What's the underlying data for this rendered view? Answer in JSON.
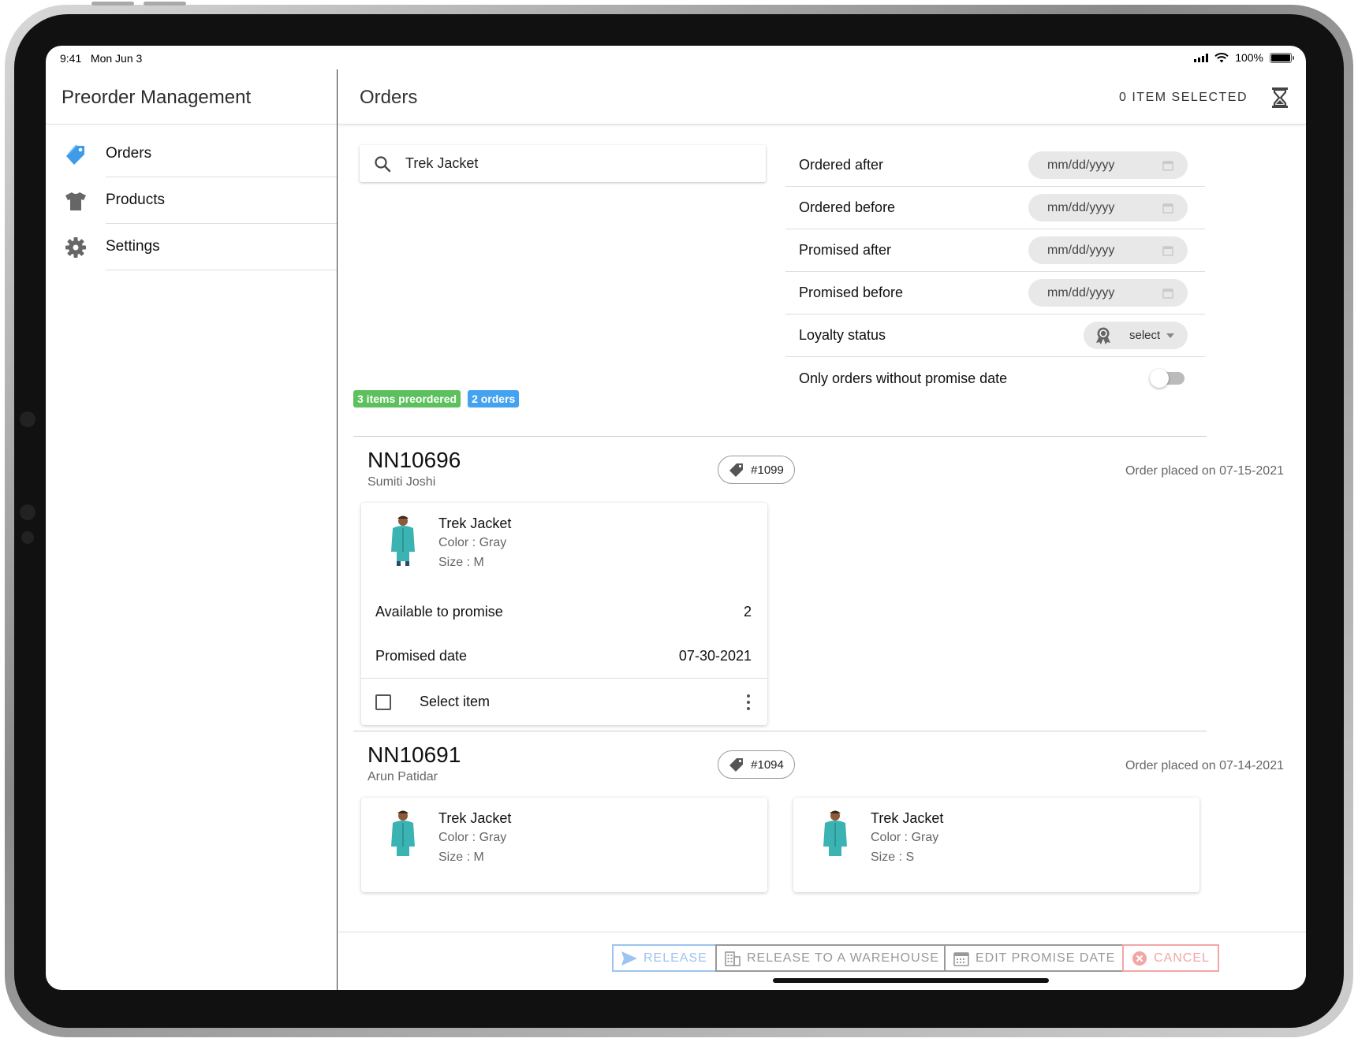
{
  "status_bar": {
    "time": "9:41",
    "date": "Mon Jun 3",
    "battery": "100%"
  },
  "sidebar": {
    "title": "Preorder Management",
    "items": [
      {
        "label": "Orders",
        "icon": "pricetag-icon",
        "color": "#3d9be9"
      },
      {
        "label": "Products",
        "icon": "shirt-icon",
        "color": "#666666"
      },
      {
        "label": "Settings",
        "icon": "gear-icon",
        "color": "#666666"
      }
    ]
  },
  "header": {
    "title": "Orders",
    "selected_count": "0 ITEM SELECTED",
    "icon": "hourglass-icon"
  },
  "search": {
    "value": "Trek Jacket",
    "icon": "search-icon"
  },
  "filters": {
    "ordered_after": {
      "label": "Ordered after",
      "value": "mm/dd/yyyy"
    },
    "ordered_before": {
      "label": "Ordered before",
      "value": "mm/dd/yyyy"
    },
    "promised_after": {
      "label": "Promised after",
      "value": "mm/dd/yyyy"
    },
    "promised_before": {
      "label": "Promised before",
      "value": "mm/dd/yyyy"
    },
    "loyalty": {
      "label": "Loyalty status",
      "value": "select",
      "icon": "ribbon-icon"
    },
    "no_promise": {
      "label": "Only orders without promise date",
      "enabled": false
    }
  },
  "summary": {
    "items_badge": "3 items preordered",
    "orders_badge": "2 orders",
    "items_color": "#5cc05c",
    "orders_color": "#44a3f0"
  },
  "orders": [
    {
      "id": "NN10696",
      "customer": "Sumiti Joshi",
      "tag": "#1099",
      "placed": "Order placed on 07-15-2021",
      "items": [
        {
          "name": "Trek Jacket",
          "color": "Color : Gray",
          "size": "Size : M",
          "atp_label": "Available to promise",
          "atp_value": "2",
          "promised_label": "Promised date",
          "promised_value": "07-30-2021",
          "select_label": "Select item"
        }
      ]
    },
    {
      "id": "NN10691",
      "customer": "Arun Patidar",
      "tag": "#1094",
      "placed": "Order placed on 07-14-2021",
      "items": [
        {
          "name": "Trek Jacket",
          "color": "Color : Gray",
          "size": "Size : M"
        },
        {
          "name": "Trek Jacket",
          "color": "Color : Gray",
          "size": "Size : S"
        }
      ]
    }
  ],
  "footer": {
    "release": "RELEASE",
    "release_warehouse": "RELEASE TO A WAREHOUSE",
    "edit_promise": "EDIT PROMISE DATE",
    "cancel": "CANCEL",
    "release_color": "#9cc4ef",
    "neutral_color": "#999999",
    "cancel_color": "#f2a6a6"
  }
}
